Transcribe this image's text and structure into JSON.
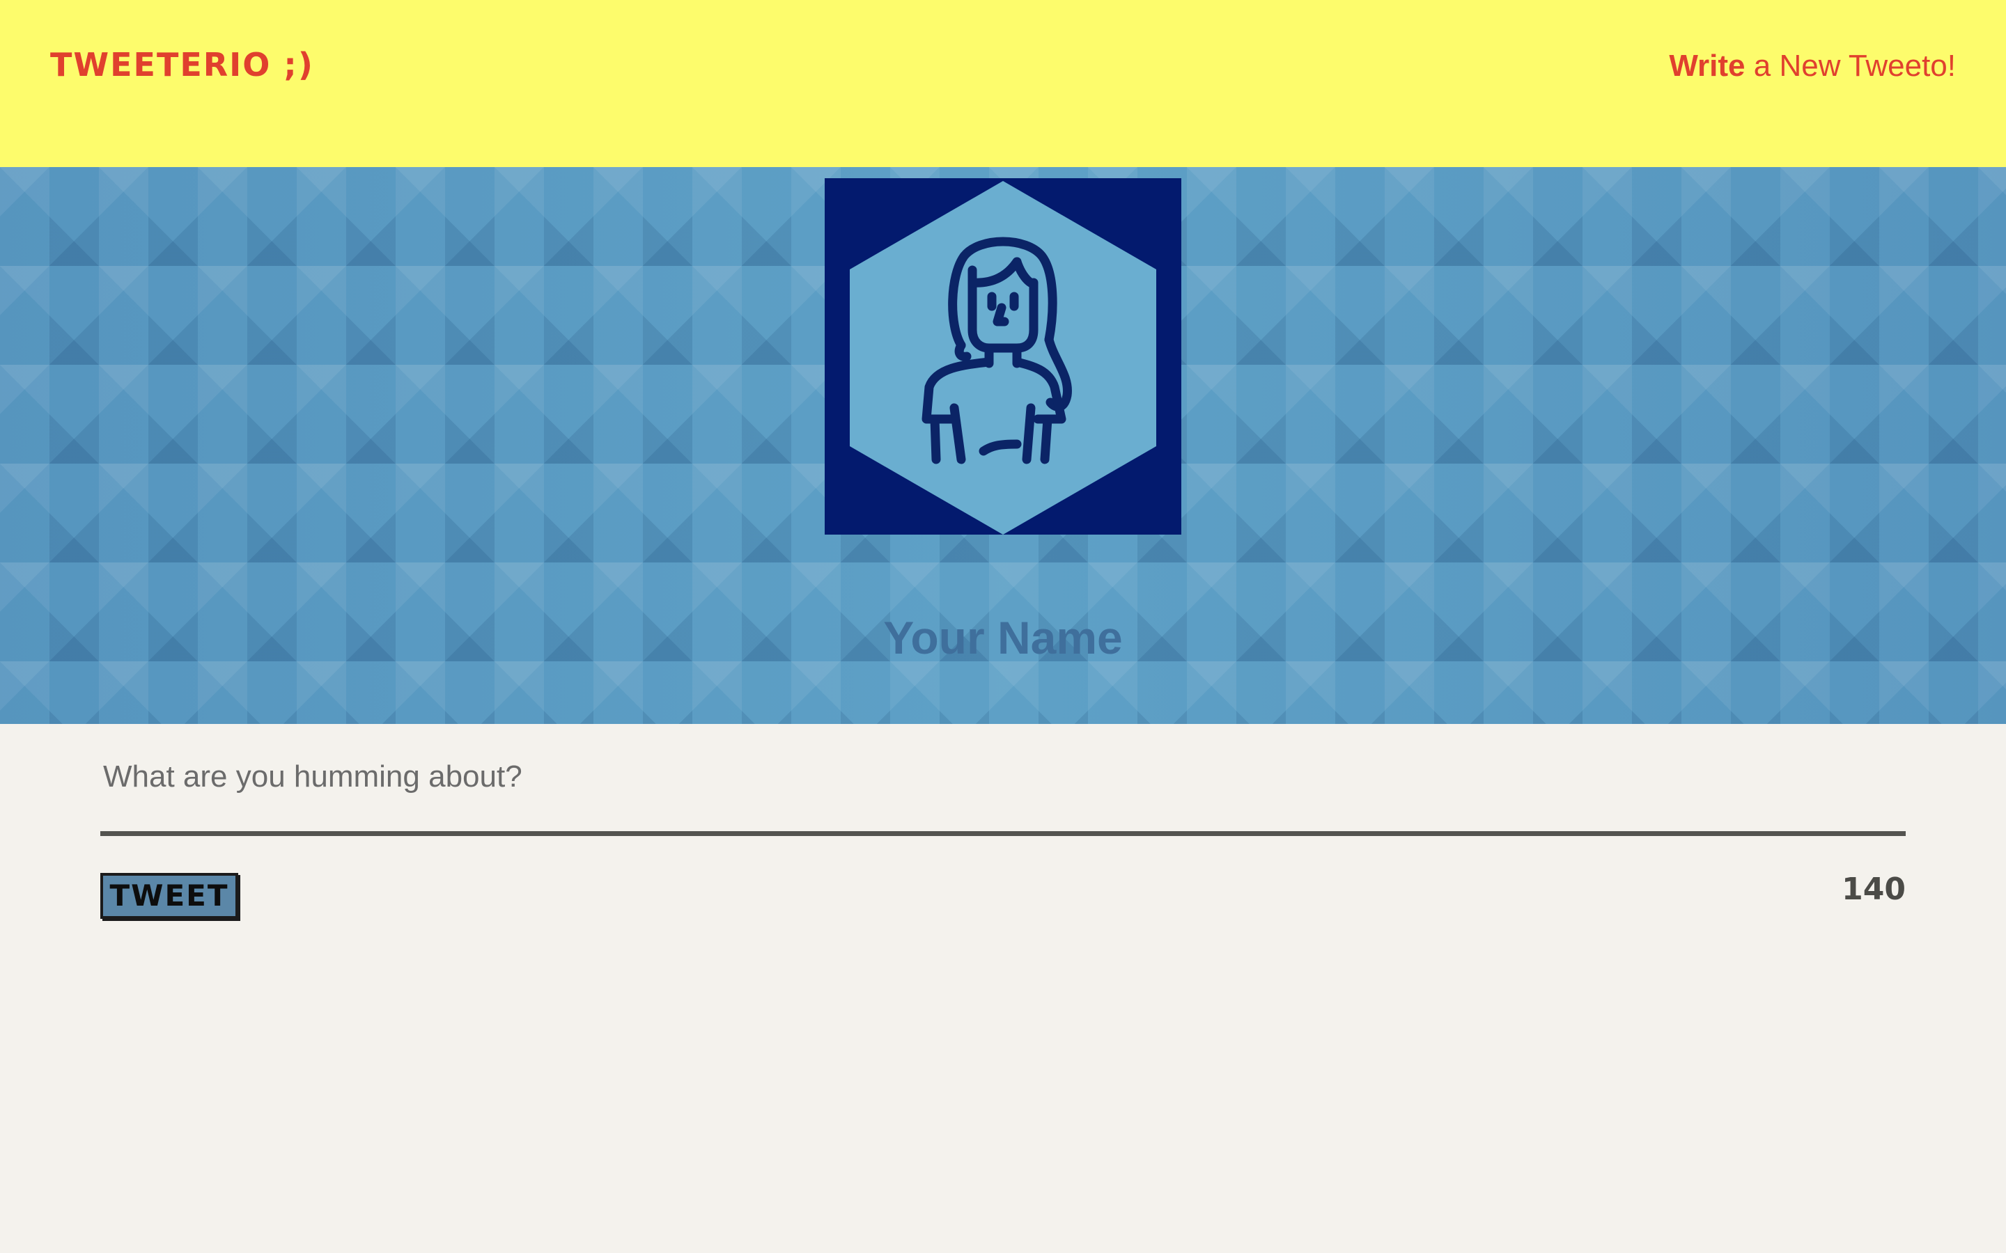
{
  "nav": {
    "brand": "TWEETERIO ;)",
    "compose_bold": "Write",
    "compose_rest": " a New Tweeto!"
  },
  "profile": {
    "name": "Your Name",
    "avatar_icon": "woman-avatar-icon"
  },
  "composer": {
    "placeholder": "What are you humming about?",
    "value": "",
    "tweet_label": "TWEET",
    "char_count": "140"
  },
  "colors": {
    "nav_bg": "#fdfc6c",
    "accent_red": "#e0402e",
    "header_blue": "#5b9dc4",
    "avatar_bg": "#031a6e",
    "page_bg": "#f4f2ed",
    "button_bg": "#5b87a8"
  }
}
